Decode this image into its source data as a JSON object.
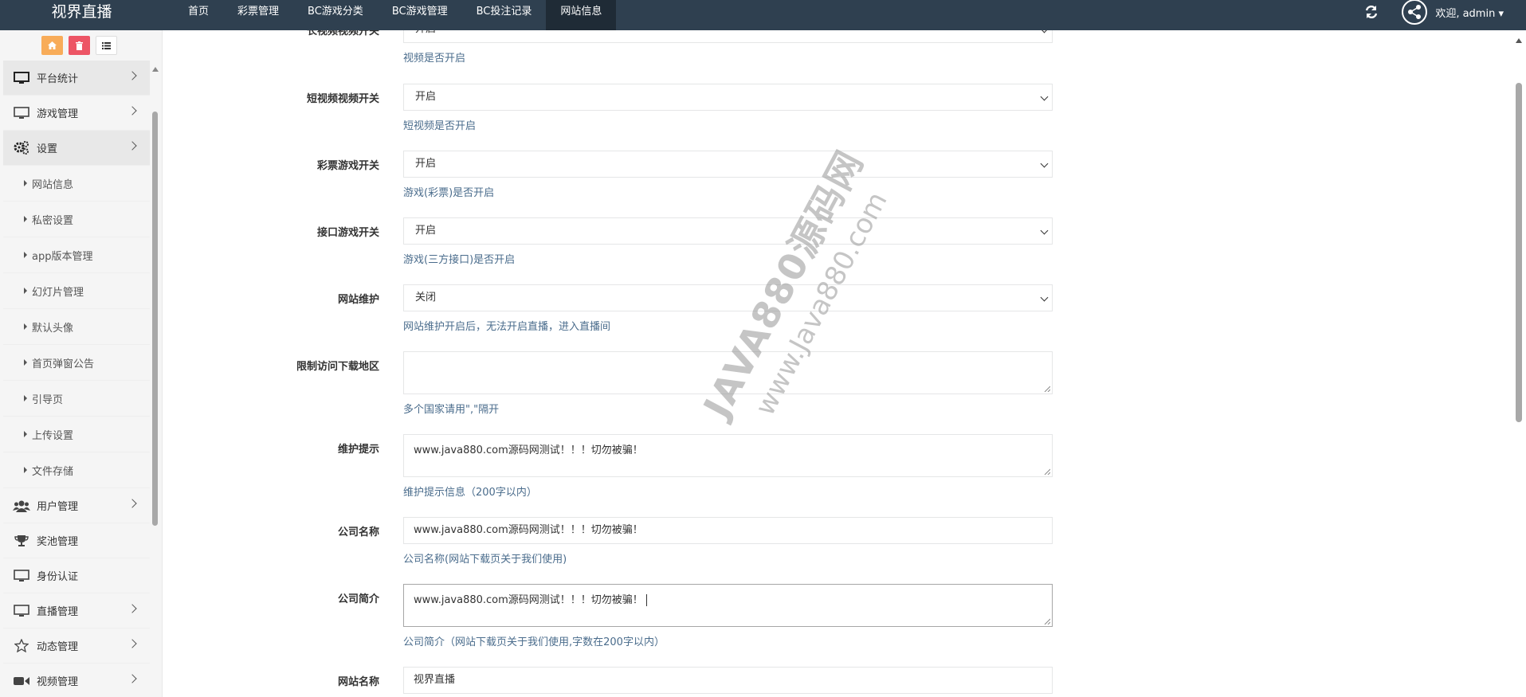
{
  "header": {
    "brand": "视界直播",
    "nav": [
      {
        "label": "首页",
        "active": false
      },
      {
        "label": "彩票管理",
        "active": false
      },
      {
        "label": "BC游戏分类",
        "active": false
      },
      {
        "label": "BC游戏管理",
        "active": false
      },
      {
        "label": "BC投注记录",
        "active": false
      },
      {
        "label": "网站信息",
        "active": true
      }
    ],
    "user_label": "欢迎, admin"
  },
  "sidebar": {
    "menu": [
      {
        "label": "平台统计",
        "icon": "monitor-icon",
        "has_children": true
      },
      {
        "label": "游戏管理",
        "icon": "monitor-icon",
        "has_children": true
      },
      {
        "label": "设置",
        "icon": "gears-icon",
        "has_children": true
      }
    ],
    "settings_children": [
      "网站信息",
      "私密设置",
      "app版本管理",
      "幻灯片管理",
      "默认头像",
      "首页弹窗公告",
      "引导页",
      "上传设置",
      "文件存储"
    ],
    "menu_after": [
      {
        "label": "用户管理",
        "icon": "users-icon",
        "has_children": true
      },
      {
        "label": "奖池管理",
        "icon": "trophy-icon",
        "has_children": false
      },
      {
        "label": "身份认证",
        "icon": "monitor-icon",
        "has_children": false
      },
      {
        "label": "直播管理",
        "icon": "monitor-icon",
        "has_children": true
      },
      {
        "label": "动态管理",
        "icon": "star-icon",
        "has_children": true
      },
      {
        "label": "视频管理",
        "icon": "video-icon",
        "has_children": true
      }
    ]
  },
  "form": {
    "long_video": {
      "label": "长视频视频开关",
      "value": "开启",
      "help": "视频是否开启"
    },
    "short_video": {
      "label": "短视频视频开关",
      "value": "开启",
      "help": "短视频是否开启"
    },
    "lottery": {
      "label": "彩票游戏开关",
      "value": "开启",
      "help": "游戏(彩票)是否开启"
    },
    "api_game": {
      "label": "接口游戏开关",
      "value": "开启",
      "help": "游戏(三方接口)是否开启"
    },
    "maintenance": {
      "label": "网站维护",
      "value": "关闭",
      "help": "网站维护开启后，无法开启直播，进入直播间"
    },
    "restrict_region": {
      "label": "限制访问下载地区",
      "value": "",
      "help": "多个国家请用\",\"隔开"
    },
    "maint_tip": {
      "label": "维护提示",
      "value": "www.java880.com源码网测试！！！切勿被骗！",
      "help": "维护提示信息（200字以内）"
    },
    "company_name": {
      "label": "公司名称",
      "value": "www.java880.com源码网测试！！！切勿被骗！",
      "help": "公司名称(网站下载页关于我们使用)"
    },
    "company_intro": {
      "label": "公司简介",
      "value": "www.java880.com源码网测试！！！切勿被骗！",
      "help": "公司简介（网站下载页关于我们使用,字数在200字以内）"
    },
    "site_name": {
      "label": "网站名称",
      "value": "视界直播"
    }
  },
  "watermark": {
    "line1": "JAVA880源码网",
    "line2": "www.Java880.com"
  },
  "colors": {
    "topbar": "#2f4050",
    "help_text": "#4a6c8c",
    "btn_orange": "#f8ac59",
    "btn_red": "#ed5565"
  }
}
